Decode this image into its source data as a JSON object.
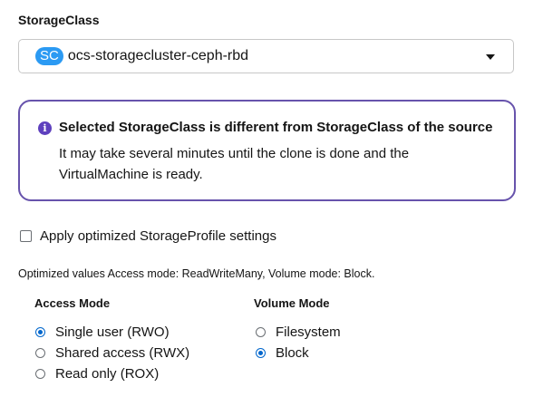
{
  "storage_class": {
    "label": "StorageClass",
    "badge": "SC",
    "value": "ocs-storagecluster-ceph-rbd"
  },
  "alert": {
    "icon": "info-icon",
    "title": "Selected StorageClass is different from StorageClass of the source",
    "body": "It may take several minutes until the clone is done and the VirtualMachine is ready."
  },
  "optimize": {
    "label": "Apply optimized StorageProfile settings",
    "checked": false
  },
  "hint": "Optimized values Access mode: ReadWriteMany, Volume mode: Block.",
  "access_mode": {
    "title": "Access Mode",
    "options": [
      {
        "label": "Single user (RWO)",
        "checked": true
      },
      {
        "label": "Shared access (RWX)",
        "checked": false
      },
      {
        "label": "Read only (ROX)",
        "checked": false
      }
    ]
  },
  "volume_mode": {
    "title": "Volume Mode",
    "options": [
      {
        "label": "Filesystem",
        "checked": false
      },
      {
        "label": "Block",
        "checked": true
      }
    ]
  },
  "colors": {
    "accent": "#0066cc",
    "alert_border": "#6753ac",
    "badge": "#2b9af3"
  }
}
